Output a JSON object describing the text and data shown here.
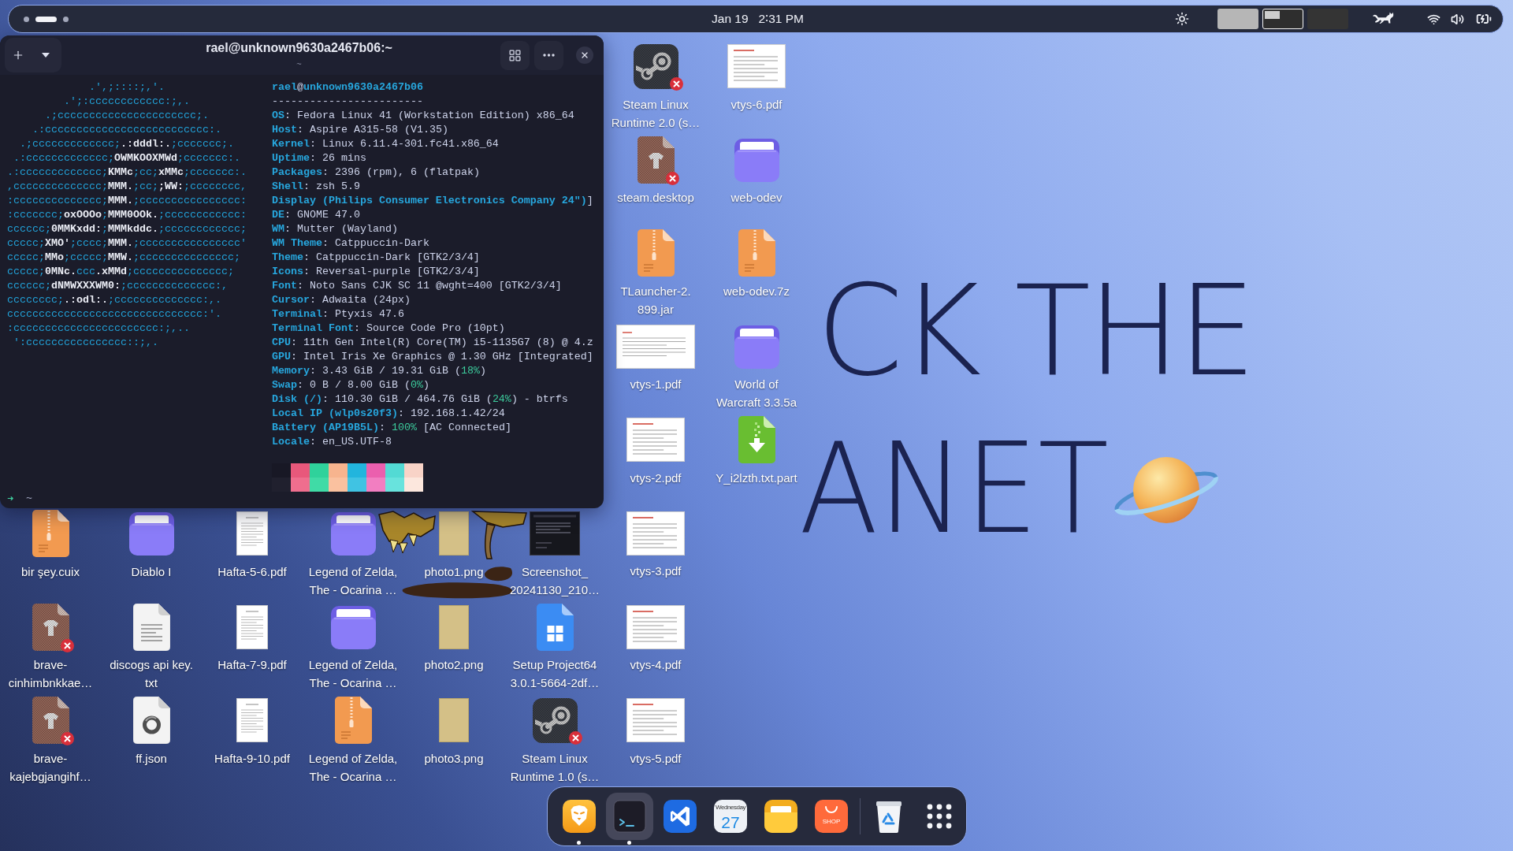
{
  "top_bar": {
    "workspaces": [
      {
        "selected": false
      },
      {
        "selected": true
      },
      {
        "selected": false
      }
    ],
    "clock": "Jan 19   2∶31 PM",
    "workspace_thumbnails": [
      {
        "kind": "filled",
        "selected": false
      },
      {
        "kind": "window",
        "selected": true
      },
      {
        "kind": "empty",
        "selected": false
      }
    ]
  },
  "terminal": {
    "title": "rael@unknown9630a2467b06:~",
    "subtitle": "~",
    "logo": [
      "             .',;::::;,'.",
      "         .';:cccccccccccc:;,.",
      "      .;cccccccccccccccccccccc;.",
      "    .:cccccccccccccccccccccccccc:.",
      "  .;ccccccccccccc;**.:dddl:.**;ccccccc;.",
      " .:ccccccccccccc;**OWMKOOXMWd**;ccccccc:.",
      ".:ccccccccccccc;**KMMc**;cc;**xMMc**;ccccccc:.",
      ",cccccccccccccc;**MMM.**;cc;**;WW:**;cccccccc,",
      ":cccccccccccccc;**MMM.**;cccccccccccccccc:",
      ":ccccccc;**oxOOOo**;**MMM0OOk.**;cccccccccccc:",
      "cccccc;**0MMKxdd:**;**MMMkddc.**;cccccccccccc;",
      "ccccc;**XMO'**;cccc;**MMM.**;cccccccccccccccc'",
      "ccccc;**MMo**;ccccc;**MMW.**;ccccccccccccccc;",
      "ccccc;**0MNc.**ccc**.xMMd**;ccccccccccccccc;",
      "cccccc;**dNMWXXXWM0:**;cccccccccccccc:,",
      "cccccccc;**.:odl:.**;cccccccccccccc:,.",
      "ccccccccccccccccccccccccccccccc:'.",
      ":ccccccccccccccccccccccc:;,..",
      " ':cccccccccccccccc::;,."
    ],
    "info": [
      [
        {
          "kind": "key",
          "text": "rael"
        },
        {
          "kind": "plain",
          "text": "@"
        },
        {
          "kind": "key",
          "text": "unknown9630a2467b06"
        }
      ],
      [
        {
          "kind": "plain",
          "text": "------------------------"
        }
      ],
      [
        {
          "kind": "key",
          "text": "OS"
        },
        {
          "kind": "plain",
          "text": ": Fedora Linux 41 (Workstation Edition) x86_64"
        }
      ],
      [
        {
          "kind": "key",
          "text": "Host"
        },
        {
          "kind": "plain",
          "text": ": Aspire A315-58 (V1.35)"
        }
      ],
      [
        {
          "kind": "key",
          "text": "Kernel"
        },
        {
          "kind": "plain",
          "text": ": Linux 6.11.4-301.fc41.x86_64"
        }
      ],
      [
        {
          "kind": "key",
          "text": "Uptime"
        },
        {
          "kind": "plain",
          "text": ": 26 mins"
        }
      ],
      [
        {
          "kind": "key",
          "text": "Packages"
        },
        {
          "kind": "plain",
          "text": ": 2396 (rpm), 6 (flatpak)"
        }
      ],
      [
        {
          "kind": "key",
          "text": "Shell"
        },
        {
          "kind": "plain",
          "text": ": zsh 5.9"
        }
      ],
      [
        {
          "kind": "key",
          "text": "Display (Philips Consumer Electronics Company 24\")"
        },
        {
          "kind": "plain",
          "text": "]"
        }
      ],
      [
        {
          "kind": "key",
          "text": "DE"
        },
        {
          "kind": "plain",
          "text": ": GNOME 47.0"
        }
      ],
      [
        {
          "kind": "key",
          "text": "WM"
        },
        {
          "kind": "plain",
          "text": ": Mutter (Wayland)"
        }
      ],
      [
        {
          "kind": "key",
          "text": "WM Theme"
        },
        {
          "kind": "plain",
          "text": ": Catppuccin-Dark"
        }
      ],
      [
        {
          "kind": "key",
          "text": "Theme"
        },
        {
          "kind": "plain",
          "text": ": Catppuccin-Dark [GTK2/3/4]"
        }
      ],
      [
        {
          "kind": "key",
          "text": "Icons"
        },
        {
          "kind": "plain",
          "text": ": Reversal-purple [GTK2/3/4]"
        }
      ],
      [
        {
          "kind": "key",
          "text": "Font"
        },
        {
          "kind": "plain",
          "text": ": Noto Sans CJK SC 11 @wght=400 [GTK2/3/4]"
        }
      ],
      [
        {
          "kind": "key",
          "text": "Cursor"
        },
        {
          "kind": "plain",
          "text": ": Adwaita (24px)"
        }
      ],
      [
        {
          "kind": "key",
          "text": "Terminal"
        },
        {
          "kind": "plain",
          "text": ": Ptyxis 47.6"
        }
      ],
      [
        {
          "kind": "key",
          "text": "Terminal Font"
        },
        {
          "kind": "plain",
          "text": ": Source Code Pro (10pt)"
        }
      ],
      [
        {
          "kind": "key",
          "text": "CPU"
        },
        {
          "kind": "plain",
          "text": ": 11th Gen Intel(R) Core(TM) i5-1135G7 (8) @ 4.z"
        }
      ],
      [
        {
          "kind": "key",
          "text": "GPU"
        },
        {
          "kind": "plain",
          "text": ": Intel Iris Xe Graphics @ 1.30 GHz [Integrated]"
        }
      ],
      [
        {
          "kind": "key",
          "text": "Memory"
        },
        {
          "kind": "plain",
          "text": ": 3.43 GiB / 19.31 GiB ("
        },
        {
          "kind": "accent",
          "text": "18%"
        },
        {
          "kind": "plain",
          "text": ")"
        }
      ],
      [
        {
          "kind": "key",
          "text": "Swap"
        },
        {
          "kind": "plain",
          "text": ": 0 B / 8.00 GiB ("
        },
        {
          "kind": "accent",
          "text": "0%"
        },
        {
          "kind": "plain",
          "text": ")"
        }
      ],
      [
        {
          "kind": "key",
          "text": "Disk (/)"
        },
        {
          "kind": "plain",
          "text": ": 110.30 GiB / 464.76 GiB ("
        },
        {
          "kind": "accent",
          "text": "24%"
        },
        {
          "kind": "plain",
          "text": ") - btrfs"
        }
      ],
      [
        {
          "kind": "key",
          "text": "Local IP (wlp0s20f3)"
        },
        {
          "kind": "plain",
          "text": ": 192.168.1.42/24"
        }
      ],
      [
        {
          "kind": "key",
          "text": "Battery (AP19B5L)"
        },
        {
          "kind": "plain",
          "text": ": "
        },
        {
          "kind": "accent",
          "text": "100%"
        },
        {
          "kind": "plain",
          "text": " [AC Connected]"
        }
      ],
      [
        {
          "kind": "key",
          "text": "Locale"
        },
        {
          "kind": "plain",
          "text": ": en_US.UTF-8"
        }
      ]
    ],
    "palette": [
      [
        {
          "color": "#181825"
        },
        {
          "color": "#e8587b"
        },
        {
          "color": "#2fd29b"
        },
        {
          "color": "#f7b48e"
        },
        {
          "color": "#22b5dd"
        },
        {
          "color": "#eb5fae"
        },
        {
          "color": "#53dad4"
        },
        {
          "color": "#f8d3c7"
        }
      ],
      [
        {
          "color": "#20202e"
        },
        {
          "color": "#ef6e8e"
        },
        {
          "color": "#40dba6"
        },
        {
          "color": "#fac19f"
        },
        {
          "color": "#40c3e3"
        },
        {
          "color": "#f27ec1"
        },
        {
          "color": "#68e3dd"
        },
        {
          "color": "#fce7dd"
        }
      ]
    ],
    "prompt": {
      "symbol": "➜",
      "path": "~"
    }
  },
  "desktop": {
    "right_columns": [
      [
        {
          "kind": "steam",
          "broken": true,
          "label_lines": [
            "Steam Linux",
            "Runtime 2.0 (s…"
          ]
        },
        {
          "kind": "shirt",
          "broken": true,
          "label_lines": [
            "steam.desktop"
          ]
        },
        {
          "kind": "archive",
          "broken": false,
          "label_lines": [
            "TLauncher-2.",
            "899.jar"
          ]
        },
        {
          "kind": "pdf-wide",
          "broken": false,
          "label_lines": [
            "vtys-1.pdf"
          ]
        },
        {
          "kind": "pdf-slide",
          "broken": false,
          "label_lines": [
            "vtys-2.pdf"
          ]
        },
        {
          "kind": "pdf-slide",
          "broken": false,
          "label_lines": [
            "vtys-3.pdf"
          ]
        },
        {
          "kind": "pdf-slide",
          "broken": false,
          "label_lines": [
            "vtys-4.pdf"
          ]
        },
        {
          "kind": "pdf-slide",
          "broken": false,
          "label_lines": [
            "vtys-5.pdf"
          ]
        }
      ],
      [
        {
          "kind": "pdf-slide",
          "broken": false,
          "label_lines": [
            "vtys-6.pdf"
          ]
        },
        {
          "kind": "folder",
          "broken": false,
          "label_lines": [
            "web-odev"
          ]
        },
        {
          "kind": "archive",
          "broken": false,
          "label_lines": [
            "web-odev.7z"
          ]
        },
        {
          "kind": "folder",
          "broken": false,
          "label_lines": [
            "World of",
            "Warcraft 3.3.5a"
          ]
        },
        {
          "kind": "download",
          "broken": false,
          "label_lines": [
            "Y_i2lzth.txt.part"
          ]
        }
      ]
    ],
    "bottom_rows": [
      [
        {
          "kind": "archive",
          "broken": false,
          "label_lines": [
            "bir şey.cuix"
          ]
        },
        {
          "kind": "folder",
          "broken": false,
          "label_lines": [
            "Diablo I"
          ]
        },
        {
          "kind": "pdf-page",
          "broken": false,
          "label_lines": [
            "Hafta-5-6.pdf"
          ]
        },
        {
          "kind": "folder",
          "broken": false,
          "label_lines": [
            "Legend of Zelda,",
            "The - Ocarina …"
          ]
        },
        {
          "kind": "photo",
          "broken": false,
          "label_lines": [
            "photo1.png"
          ]
        },
        {
          "kind": "screenshot",
          "broken": false,
          "label_lines": [
            "Screenshot_",
            "20241130_210…"
          ]
        }
      ],
      [
        {
          "kind": "shirt",
          "broken": true,
          "label_lines": [
            "brave-",
            "cinhimbnkkae…"
          ]
        },
        {
          "kind": "text",
          "broken": false,
          "label_lines": [
            "discogs api key.",
            "txt"
          ]
        },
        {
          "kind": "pdf-page",
          "broken": false,
          "label_lines": [
            "Hafta-7-9.pdf"
          ]
        },
        {
          "kind": "folder",
          "broken": false,
          "label_lines": [
            "Legend of Zelda,",
            "The - Ocarina …"
          ]
        },
        {
          "kind": "photo",
          "broken": false,
          "label_lines": [
            "photo2.png"
          ]
        },
        {
          "kind": "windows",
          "broken": false,
          "label_lines": [
            "Setup Project64",
            "3.0.1-5664-2df…"
          ]
        }
      ],
      [
        {
          "kind": "shirt",
          "broken": true,
          "label_lines": [
            "brave-",
            "kajebgjangihf…"
          ]
        },
        {
          "kind": "json",
          "broken": false,
          "label_lines": [
            "ff.json"
          ]
        },
        {
          "kind": "pdf-page",
          "broken": false,
          "label_lines": [
            "Hafta-9-10.pdf"
          ]
        },
        {
          "kind": "archive",
          "broken": false,
          "label_lines": [
            "Legend of Zelda,",
            "The - Ocarina …"
          ]
        },
        {
          "kind": "photo",
          "broken": false,
          "label_lines": [
            "photo3.png"
          ]
        },
        {
          "kind": "steam",
          "broken": true,
          "label_lines": [
            "Steam Linux",
            "Runtime 1.0 (s…"
          ]
        }
      ]
    ]
  },
  "wallpaper": {
    "lines": [
      "CK THE",
      "ANET"
    ]
  },
  "dock": {
    "apps": [
      {
        "kind": "lion",
        "running": true,
        "active": false
      },
      {
        "kind": "terminal",
        "running": true,
        "active": true
      },
      {
        "kind": "editor",
        "running": false,
        "active": false
      },
      {
        "kind": "calendar",
        "weekday": "Wednesday",
        "day": "27",
        "running": false,
        "active": false
      },
      {
        "kind": "files",
        "running": false,
        "active": false
      },
      {
        "kind": "shop",
        "label": "SHOP",
        "running": false,
        "active": false
      }
    ],
    "end": [
      {
        "kind": "trash"
      },
      {
        "kind": "apps"
      }
    ]
  }
}
